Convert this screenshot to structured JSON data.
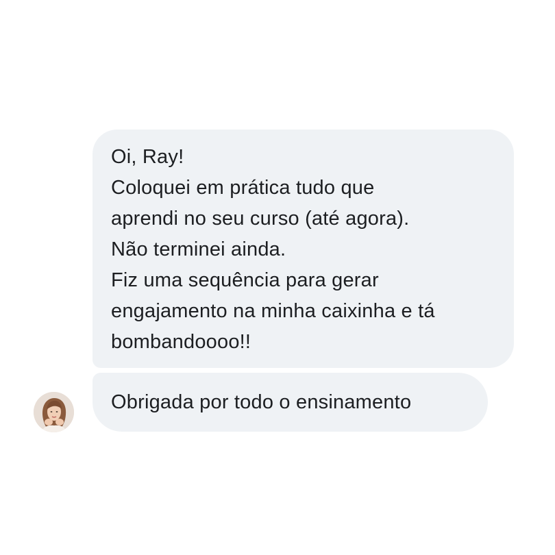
{
  "conversation": {
    "messages": [
      {
        "lines": [
          "Oi, Ray!",
          "Coloquei em prática tudo que",
          "aprendi no seu curso (até agora).",
          "Não terminei ainda.",
          "Fiz uma sequência para gerar",
          "engajamento na minha caixinha e tá",
          "bombandoooo!!"
        ]
      },
      {
        "lines": [
          "Obrigada por todo o ensinamento"
        ]
      }
    ],
    "sender_avatar_icon": "user-avatar-photo"
  },
  "colors": {
    "bubble_background": "#eff2f5",
    "text": "#1c1e21",
    "page_background": "#ffffff"
  }
}
